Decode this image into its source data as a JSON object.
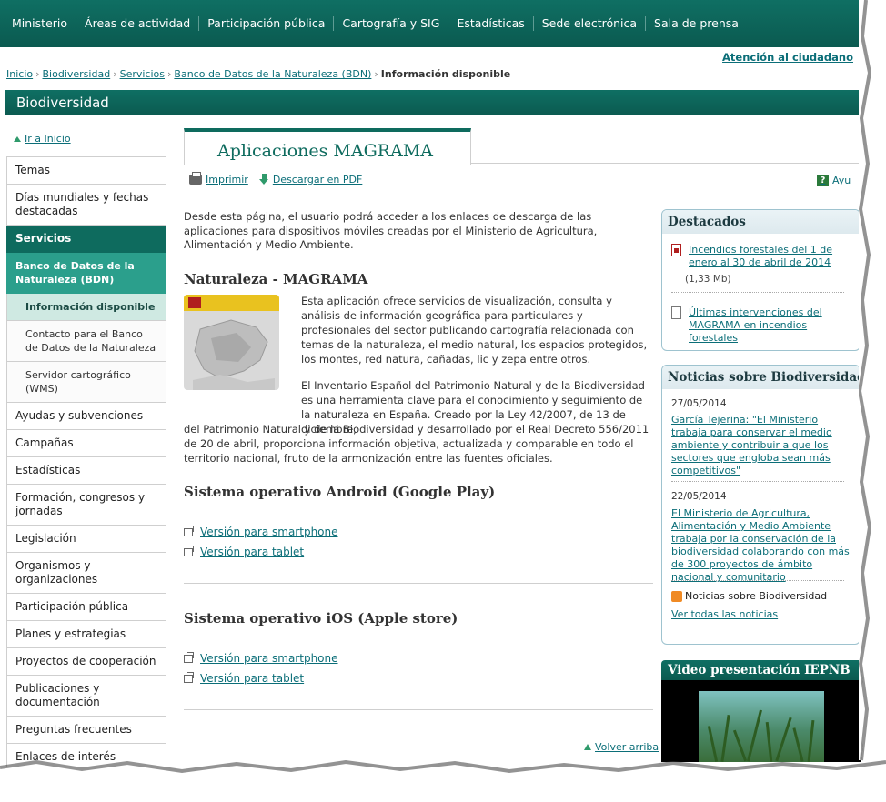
{
  "top_nav": [
    "Ministerio",
    "Áreas de actividad",
    "Participación pública",
    "Cartografía y SIG",
    "Estadísticas",
    "Sede electrónica",
    "Sala de prensa"
  ],
  "citizen_link": "Atención al ciudadano",
  "breadcrumb": {
    "items": [
      "Inicio",
      "Biodiversidad",
      "Servicios",
      "Banco de Datos de la Naturaleza (BDN)"
    ],
    "separator": "›",
    "current": "Información disponible"
  },
  "section_title": "Biodiversidad",
  "sidebar": {
    "home_link": "Ir a Inicio",
    "items": [
      "Temas",
      "Días mundiales y fechas destacadas",
      "Servicios",
      "Banco de Datos de la Naturaleza (BDN)",
      "Información disponible",
      "Contacto para el Banco de Datos de la Naturaleza",
      "Servidor cartográfico (WMS)",
      "Ayudas y subvenciones",
      "Campañas",
      "Estadísticas",
      "Formación, congresos y jornadas",
      "Legislación",
      "Organismos y organizaciones",
      "Participación pública",
      "Planes y estrategias",
      "Proyectos de cooperación",
      "Publicaciones y documentación",
      "Preguntas frecuentes",
      "Enlaces de interés"
    ]
  },
  "main": {
    "tab_title": "Aplicaciones MAGRAMA",
    "tools": {
      "print": "Imprimir",
      "pdf": "Descargar en PDF",
      "help": "Ayu"
    },
    "intro": "Desde esta página, el usuario podrá acceder a los enlaces de descarga de las aplicaciones para dispositivos móviles creadas por el Ministerio de Agricultura, Alimentación y Medio Ambiente.",
    "naturaleza": {
      "title": "Naturaleza - MAGRAMA",
      "p1": "Esta aplicación ofrece servicios de visualización, consulta y análisis de información geográfica para particulares y profesionales del sector publicando cartografía relacionada con temas de la naturaleza, el medio natural, los espacios protegidos, los montes, red natura, cañadas, lic y zepa entre otros.",
      "p2_top": "El Inventario Español del Patrimonio Natural y de la Biodiversidad es una herramienta clave para el conocimiento y seguimiento de la naturaleza en España. Creado por la Ley 42/2007, de 13 de diciembre,",
      "p2_bottom": "del Patrimonio Natural y de la Biodiversidad y desarrollado por el Real Decreto 556/2011 de 20 de abril, proporciona información objetiva, actualizada y comparable en todo el territorio nacional, fruto de la armonización entre las fuentes oficiales."
    },
    "android": {
      "title": "Sistema operativo Android (Google Play)",
      "smartphone": "Versión para smartphone",
      "tablet": "Versión para tablet"
    },
    "ios": {
      "title": "Sistema operativo iOS (Apple store)",
      "smartphone": "Versión para smartphone",
      "tablet": "Versión para tablet"
    },
    "back_top": "Volver arriba"
  },
  "destacados": {
    "title": "Destacados",
    "item1": "Incendios forestales del 1 de enero al 30 de abril de 2014",
    "item1_size": "(1,33 Mb)",
    "item2": "Últimas intervenciones del MAGRAMA en incendios forestales"
  },
  "noticias": {
    "title": "Noticias sobre Biodiversidad",
    "n1_date": "27/05/2014",
    "n1_text": "García Tejerina: \"El Ministerio trabaja para conservar el medio ambiente y contribuir a que los sectores que engloba sean más competitivos\"",
    "n2_date": "22/05/2014",
    "n2_text": "El Ministerio de Agricultura, Alimentación y Medio Ambiente trabaja por la conservación de la biodiversidad colaborando con más de 300 proyectos de ámbito nacional y comunitario",
    "rss": "Noticias sobre Biodiversidad",
    "all": "Ver todas las noticias"
  },
  "video": {
    "title": "Video presentación IEPNB"
  },
  "colors": {
    "primary": "#0e6b5e",
    "accent": "#2b9f8c",
    "link": "#0b6e78",
    "box_border": "#9ec3cf"
  }
}
